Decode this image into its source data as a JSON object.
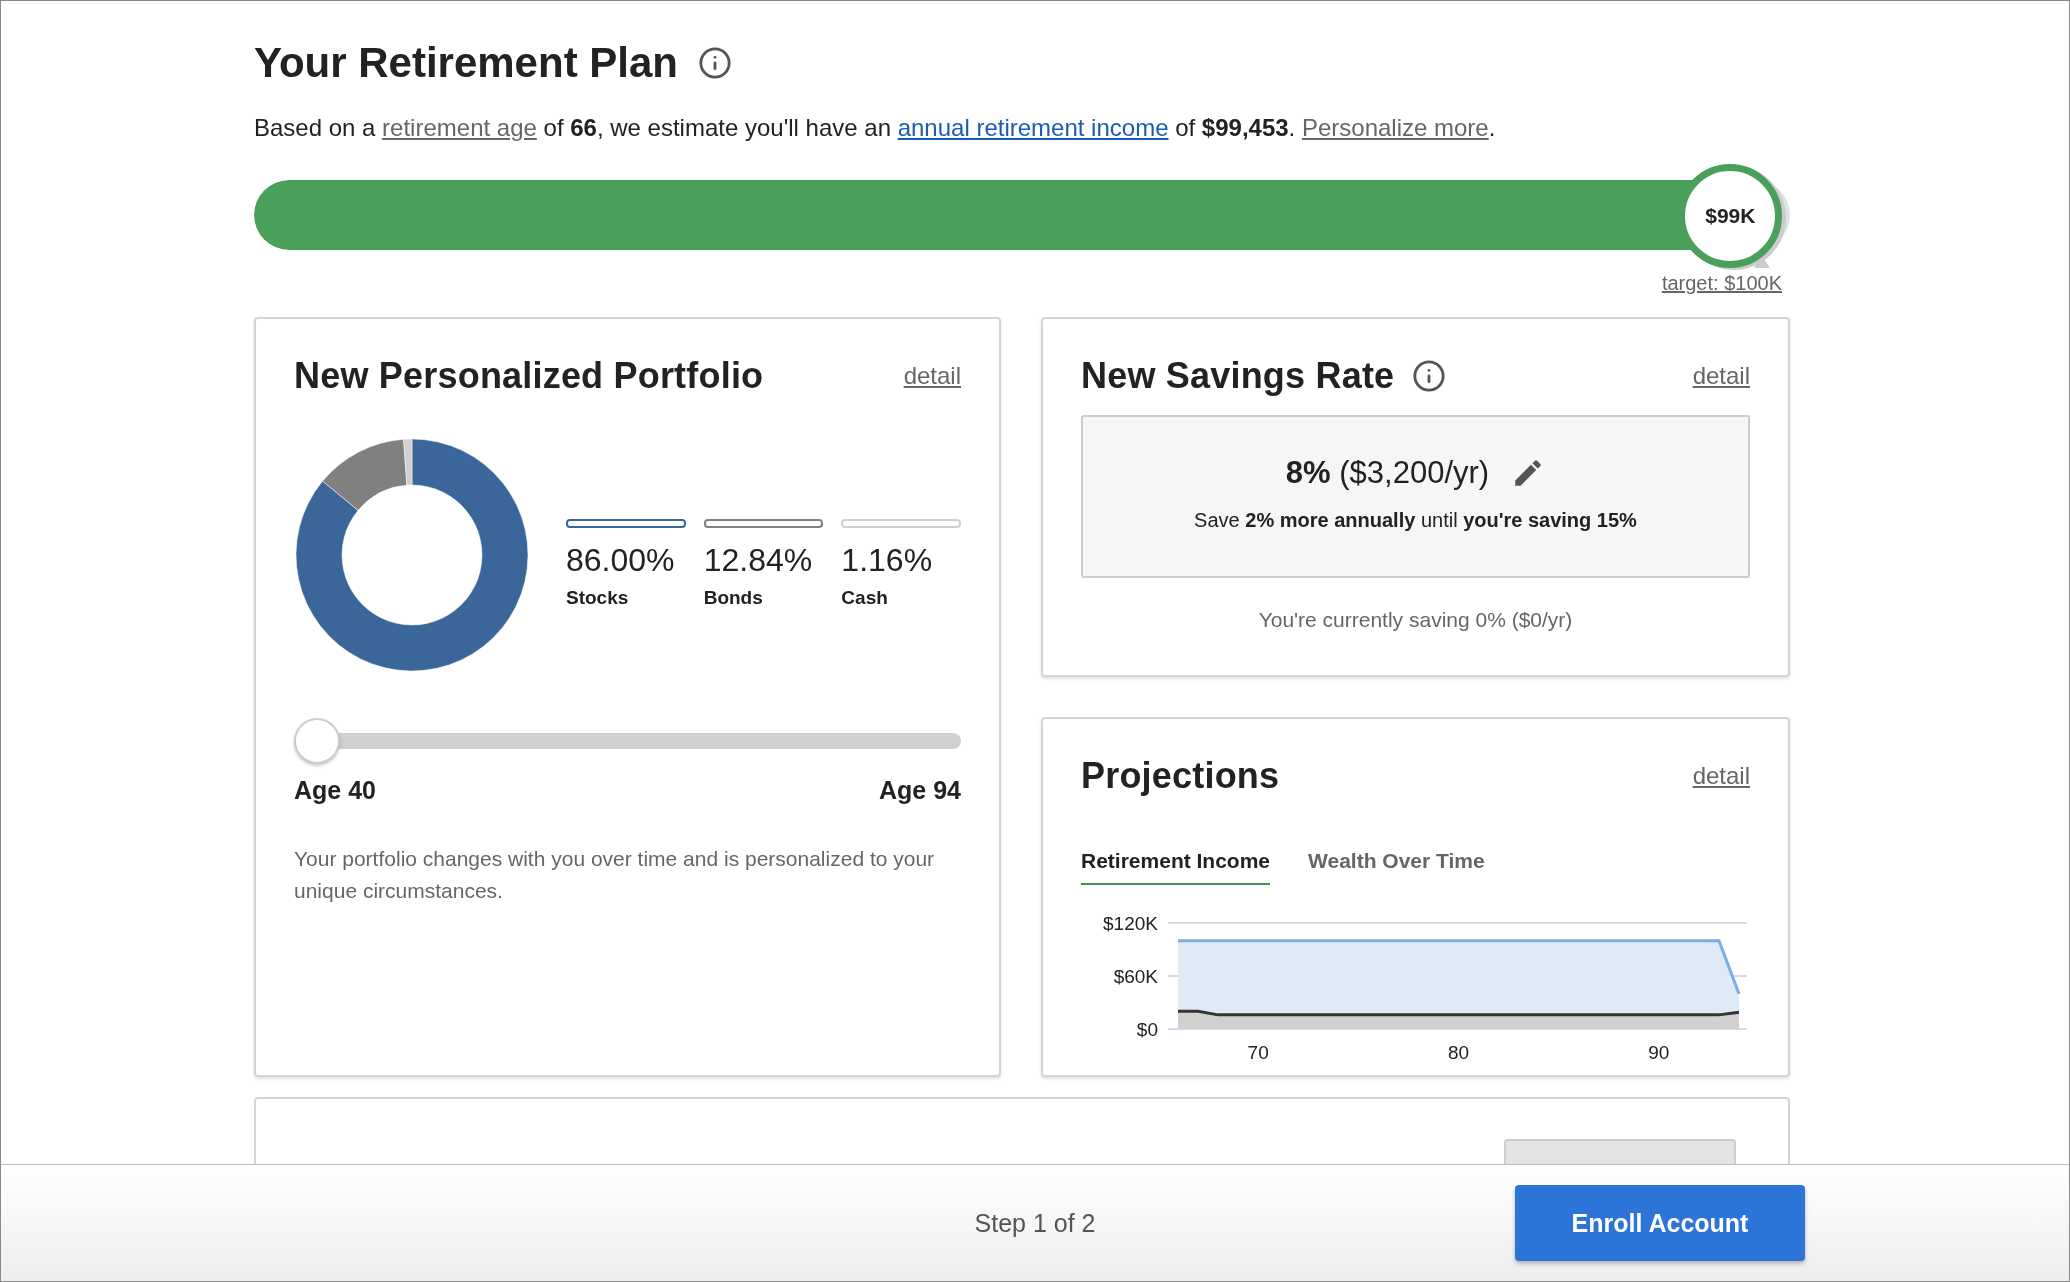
{
  "header": {
    "title": "Your Retirement Plan",
    "summary": [
      {
        "kind": "text",
        "text": "Based on a "
      },
      {
        "kind": "link",
        "text": "retirement age"
      },
      {
        "kind": "text",
        "text": " of **66**, we estimate you'll have an "
      },
      {
        "kind": "highlight-link",
        "text": "annual retirement income"
      },
      {
        "kind": "text",
        "text": " of **$99,453**. "
      },
      {
        "kind": "link",
        "text": "Personalize more"
      },
      {
        "kind": "text",
        "text": "."
      }
    ]
  },
  "progress": {
    "level": 0.995,
    "value_label": "$99K",
    "target_label": "target: $100K"
  },
  "portfolio": {
    "title": "New Personalized Portfolio",
    "detail_link": "detail",
    "chart_data": {
      "type": "donut",
      "categories": [
        "Stocks",
        "Bonds",
        "Cash"
      ],
      "values": [
        86.0,
        12.84,
        1.16
      ]
    },
    "legend": [
      {
        "value": "86.00%",
        "color": "#3b6699"
      },
      {
        "value": "12.84%",
        "color": "#808080"
      },
      {
        "value": "1.16%",
        "color": "#d0d0d0"
      }
    ],
    "age_slider": {
      "level": 0,
      "min_label": "Age 40",
      "max_label": "Age 94"
    },
    "description": "Your portfolio changes with you over time and is personalized to your unique circumstances."
  },
  "savings": {
    "title": "New Savings Rate",
    "detail_link": "detail",
    "rate": "**8%** ($3,200/yr)",
    "plan": "Save **2% more annually** until **you're saving 15%**",
    "current": "You're currently saving 0% ($0/yr)"
  },
  "projections": {
    "title": "Projections",
    "detail_link": "detail",
    "tabs": [
      {
        "label": "Retirement Income",
        "selected": true
      },
      {
        "label": "Wealth Over Time",
        "selected": false
      }
    ],
    "chart_data": {
      "type": "area",
      "x": [
        66,
        67,
        68,
        93,
        94
      ],
      "series": [
        {
          "color": "#7aaee6",
          "values": [
            100000,
            100000,
            100000,
            100000,
            40000
          ]
        },
        {
          "color": "#333333",
          "values": [
            20000,
            20000,
            16000,
            16000,
            19000
          ]
        }
      ],
      "xlim": [
        66,
        94
      ],
      "ylim": [
        0,
        120000
      ],
      "xticks": [
        70,
        80,
        90
      ],
      "yticks": [
        {
          "value": 0,
          "label": "$0"
        },
        {
          "value": 60000,
          "label": "$60K"
        },
        {
          "value": 120000,
          "label": "$120K"
        }
      ]
    }
  },
  "footer": {
    "step": "Step 1 of 2",
    "button": "Enroll Account"
  }
}
